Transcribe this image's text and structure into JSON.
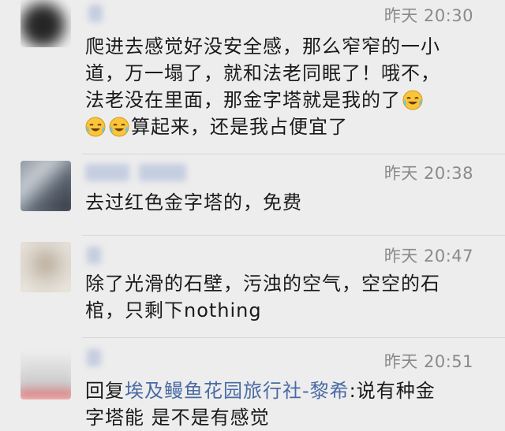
{
  "comments": [
    {
      "timestamp": "昨天 20:30",
      "lines": [
        "爬进去感觉好没安全感，那么窄窄的一小",
        "道，万一塌了，就和法老同眠了！哦不，",
        "法老没在里面，那金字塔就是我的了",
        "算起来，还是我占便宜了"
      ],
      "emoji": "laughing-crying-emoji"
    },
    {
      "timestamp": "昨天 20:38",
      "lines": [
        "去过红色金字塔的，免费"
      ]
    },
    {
      "timestamp": "昨天 20:47",
      "lines": [
        "除了光滑的石壁，污浊的空气，空空的石",
        "棺，只剩下nothing"
      ]
    },
    {
      "timestamp": "昨天 20:51",
      "reply_prefix": "回复",
      "reply_target": "埃及鳗鱼花园旅行社-黎希",
      "reply_rest": ":说有种金",
      "lines_after": [
        "字塔能 是不是有感觉"
      ]
    }
  ],
  "colors": {
    "background": "#ededed",
    "link": "#4a6aa5",
    "timestamp": "#8a8a8a",
    "text": "#1a1a1a"
  }
}
